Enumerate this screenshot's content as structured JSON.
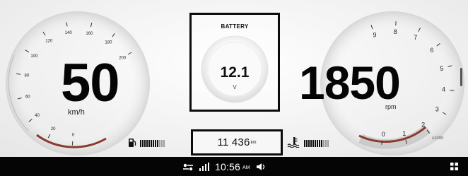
{
  "speedometer": {
    "value": "50",
    "unit": "km/h",
    "ticks": [
      "0",
      "20",
      "40",
      "60",
      "80",
      "100",
      "120",
      "140",
      "160",
      "180",
      "200"
    ]
  },
  "tachometer": {
    "value": "1850",
    "unit": "rpm",
    "multiplier": "x1000",
    "ticks": [
      "0",
      "1",
      "2",
      "3",
      "4",
      "5",
      "6",
      "7",
      "8",
      "9"
    ]
  },
  "battery": {
    "title": "BATTERY",
    "value": "12.1",
    "unit": "V"
  },
  "odometer": {
    "value": "11 436",
    "unit": "km"
  },
  "gauges": {
    "fuel_icon": "fuel-pump-icon",
    "fuel_level": 0.75,
    "coolant_icon": "coolant-temperature-icon",
    "coolant_level": 0.75
  },
  "status_bar": {
    "time": "10:56",
    "ampm": "AM",
    "icons": [
      "connection-icon",
      "signal-icon",
      "volume-icon",
      "apps-grid-icon"
    ]
  },
  "colors": {
    "needle_accent": "#a84a3a",
    "background": "#f3f3f3",
    "status_bar": "#050505"
  }
}
